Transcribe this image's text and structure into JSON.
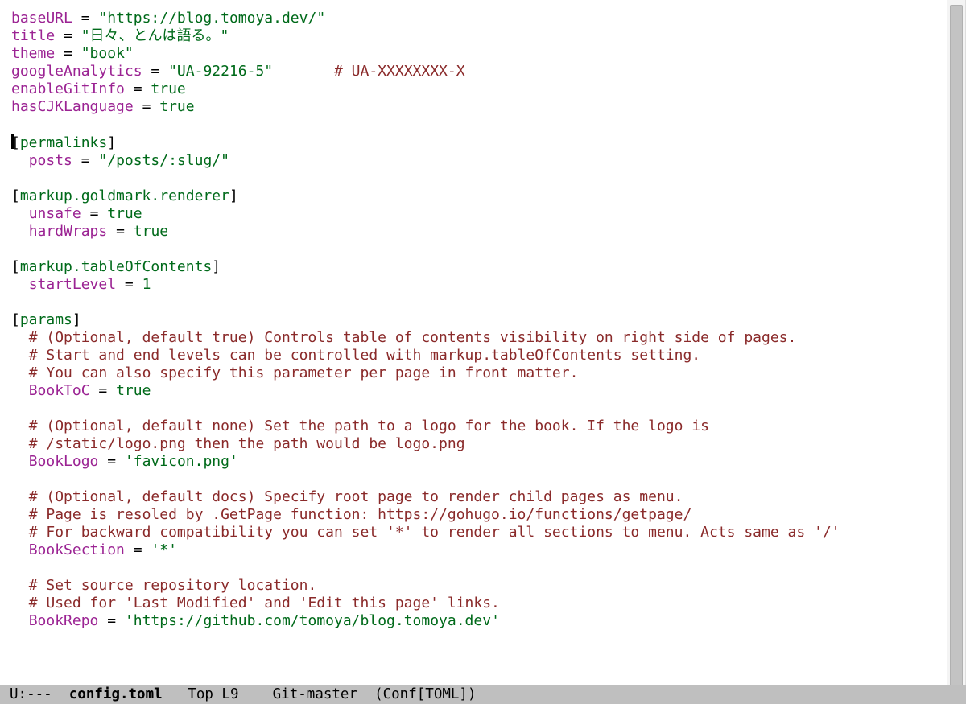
{
  "modeline": {
    "left": "U:---  ",
    "filename": "config.toml",
    "rest": "   Top L9    Git-master  (Conf[TOML])"
  },
  "c": {
    "baseURL_k": "baseURL",
    "baseURL_v": "\"https://blog.tomoya.dev/\"",
    "title_k": "title",
    "title_v": "\"日々、とんは語る。\"",
    "theme_k": "theme",
    "theme_v": "\"book\"",
    "ga_k": "googleAnalytics",
    "ga_v": "\"UA-92216-5\"",
    "ga_c": "# UA-XXXXXXXX-X",
    "git_k": "enableGitInfo",
    "git_v": "true",
    "cjk_k": "hasCJKLanguage",
    "cjk_v": "true",
    "sec_permalinks": "permalinks",
    "posts_k": "posts",
    "posts_v": "\"/posts/:slug/\"",
    "sec_gm": "markup.goldmark.renderer",
    "unsafe_k": "unsafe",
    "unsafe_v": "true",
    "hard_k": "hardWraps",
    "hard_v": "true",
    "sec_toc": "markup.tableOfContents",
    "start_k": "startLevel",
    "start_v": "1",
    "sec_params": "params",
    "pc1": "# (Optional, default true) Controls table of contents visibility on right side of pages.",
    "pc2": "# Start and end levels can be controlled with markup.tableOfContents setting.",
    "pc3": "# You can also specify this parameter per page in front matter.",
    "booktoc_k": "BookToC",
    "booktoc_v": "true",
    "lc1": "# (Optional, default none) Set the path to a logo for the book. If the logo is",
    "lc2": "# /static/logo.png then the path would be logo.png",
    "booklogo_k": "BookLogo",
    "booklogo_v": "'favicon.png'",
    "sc1": "# (Optional, default docs) Specify root page to render child pages as menu.",
    "sc2": "# Page is resoled by .GetPage function: https://gohugo.io/functions/getpage/",
    "sc3": "# For backward compatibility you can set '*' to render all sections to menu. Acts same as '/'",
    "booksec_k": "BookSection",
    "booksec_v": "'*'",
    "rc1": "# Set source repository location.",
    "rc2": "# Used for 'Last Modified' and 'Edit this page' links.",
    "bookrepo_k": "BookRepo",
    "bookrepo_v": "'https://github.com/tomoya/blog.tomoya.dev'",
    "lb": "[",
    "rb": "]"
  }
}
